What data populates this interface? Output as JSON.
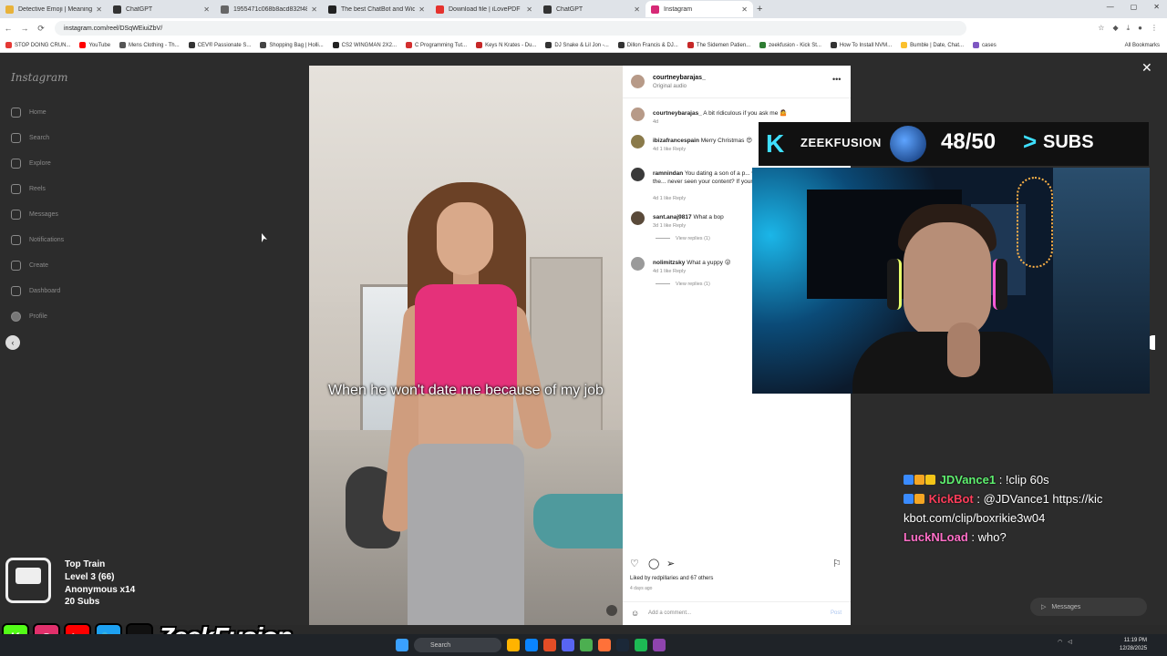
{
  "browser": {
    "tabs": [
      {
        "title": "Detective Emoji | Meaning",
        "color": "#e8b23a"
      },
      {
        "title": "ChatGPT",
        "color": "#333333"
      },
      {
        "title": "1955471c068b8acd832f48702...",
        "color": "#666666"
      },
      {
        "title": "The best ChatBot and Widget...",
        "color": "#222222"
      },
      {
        "title": "Download file | iLovePDF",
        "color": "#e5322d"
      },
      {
        "title": "ChatGPT",
        "color": "#333333"
      },
      {
        "title": "Instagram",
        "color": "#d62976"
      }
    ],
    "new_tab": "+",
    "url": "instagram.com/reel/DSqWEiuiZbV/",
    "bookmarks": [
      "STOP DOING CRUN...",
      "YouTube",
      "Mens Clothing - Th...",
      "CEV® Passionate S...",
      "Shopping Bag | Holli...",
      "CS2 WINGMAN 2X2...",
      "C Programming Tut...",
      "Keys N Krates - Du...",
      "DJ Snake & Lil Jon -...",
      "Dillon Francis & DJ...",
      "The Sidemen Patien...",
      "zeekfusion - Kick St...",
      "How To Install NVM...",
      "Bumble | Date, Chat...",
      "cases"
    ],
    "all_bookmarks": "All Bookmarks"
  },
  "instagram": {
    "logo": "Instagram",
    "nav": [
      "Home",
      "Search",
      "Explore",
      "Reels",
      "Messages",
      "Notifications",
      "Create",
      "Dashboard",
      "Profile"
    ],
    "close": "✕",
    "video_caption": "When he won't date me because of my job",
    "post": {
      "author": "courtneybarajas_",
      "audio": "Original audio",
      "author_caption_user": "courtneybarajas_",
      "author_caption": "A bit ridiculous if you ask me 🤷",
      "author_caption_time": "4d",
      "comments": [
        {
          "user": "ibizafrancespain",
          "text": "Merry Christmas 😍",
          "meta": "4d   1 like   Reply",
          "replies": ""
        },
        {
          "user": "ramnindan",
          "text": "You dating a son of a p... values fine, I think 😅 I named the... never seen your content? If your fa...",
          "meta": "4d   1 like   Reply",
          "replies": ""
        },
        {
          "user": "sant.anaj9817",
          "text": "What a bop",
          "meta": "3d   1 like   Reply",
          "replies": "View replies (1)"
        },
        {
          "user": "nolimitzsky",
          "text": "What a yuppy 😜",
          "meta": "4d   1 like   Reply",
          "replies": "View replies (1)"
        }
      ],
      "liked_by": "Liked by redpillaries and 67 others",
      "posted_ago": "4 days ago",
      "add_comment_placeholder": "Add a comment...",
      "post_label": "Post"
    }
  },
  "stream": {
    "banner": {
      "k": "K",
      "name": "ZEEKFUSION",
      "count": "48/50",
      "chevron": ">",
      "label": "SUBS"
    },
    "chat": [
      {
        "user": "JDVance1",
        "message": ": !clip 60s",
        "user_color": "#5ef06f"
      },
      {
        "user": "KickBot",
        "message": ": @JDVance1 https://kickbot.com/clip/boxrikie3w04",
        "user_color": "#ff3d5a"
      },
      {
        "user": "LuckNLoad",
        "message": ": who?",
        "user_color": "#ff6ec7"
      }
    ],
    "messages_pill": "Messages",
    "train": {
      "title": "Top Train",
      "level": "Level 3  (66)",
      "anon": "Anonymous x14",
      "subs": "20 Subs"
    },
    "brand": "ZeekFusion",
    "socials": [
      {
        "glyph": "K",
        "color": "#53fc18"
      },
      {
        "glyph": "◎",
        "color": "#e1306c"
      },
      {
        "glyph": "▶",
        "color": "#ff0000"
      },
      {
        "glyph": "🐦",
        "color": "#1da1f2"
      },
      {
        "glyph": "♪",
        "color": "#111111"
      }
    ]
  },
  "taskbar": {
    "search": "Search",
    "clock_time": "11:19 PM",
    "clock_date": "12/28/2025"
  }
}
